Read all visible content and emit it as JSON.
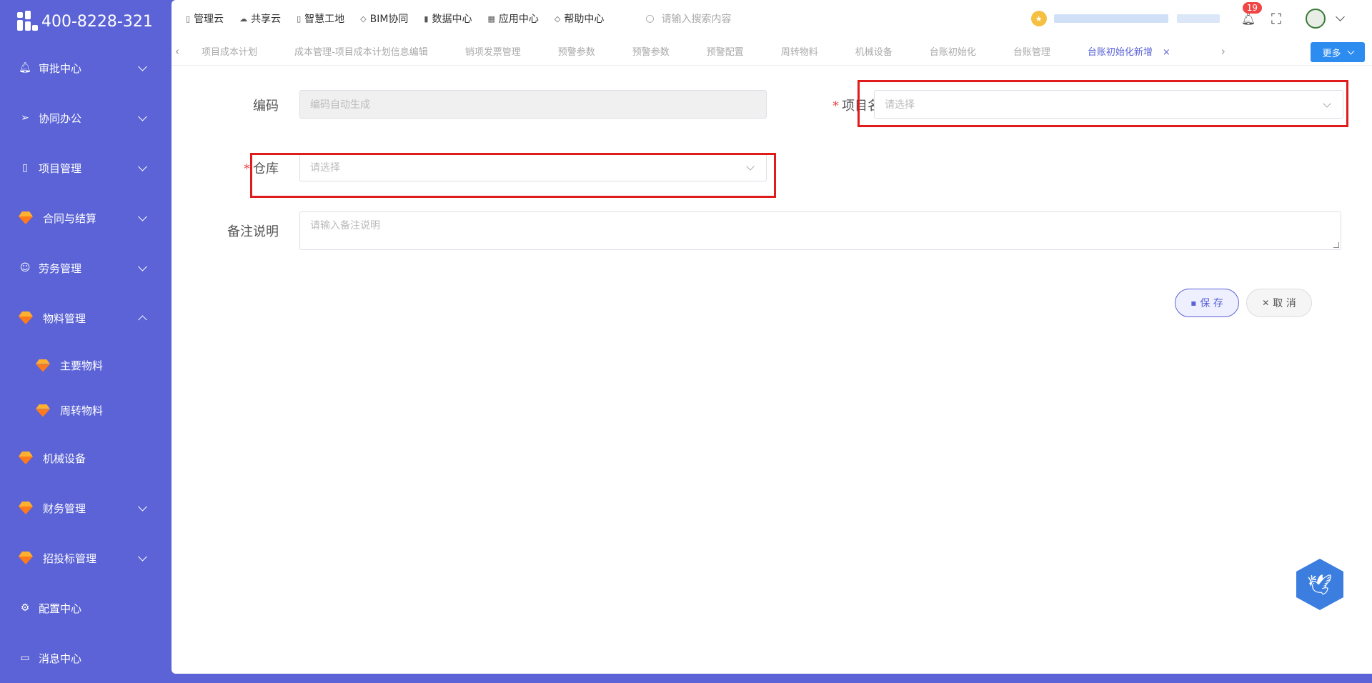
{
  "brand": {
    "phone": "400-8228-321"
  },
  "sidebar": {
    "items": [
      {
        "label": "审批中心",
        "icon": "bell-icon"
      },
      {
        "label": "协同办公",
        "icon": "send-icon"
      },
      {
        "label": "项目管理",
        "icon": "book-icon"
      },
      {
        "label": "合同与结算",
        "icon": "gem-icon"
      },
      {
        "label": "劳务管理",
        "icon": "user-icon"
      },
      {
        "label": "物料管理",
        "icon": "gem-icon"
      },
      {
        "label": "主要物料",
        "icon": "gem-icon"
      },
      {
        "label": "周转物料",
        "icon": "gem-icon"
      },
      {
        "label": "机械设备",
        "icon": "gem-icon"
      },
      {
        "label": "财务管理",
        "icon": "gem-icon"
      },
      {
        "label": "招投标管理",
        "icon": "gem-icon"
      },
      {
        "label": "配置中心",
        "icon": "gear-icon"
      },
      {
        "label": "消息中心",
        "icon": "message-icon"
      }
    ]
  },
  "topbar": {
    "menu": [
      "管理云",
      "共享云",
      "智慧工地",
      "BIM协同",
      "数据中心",
      "应用中心",
      "帮助中心"
    ],
    "search_placeholder": "请输入搜索内容",
    "notification_count": "19"
  },
  "tabs": {
    "items": [
      "项目成本计划",
      "成本管理-项目成本计划信息编辑",
      "销项发票管理",
      "预警参数",
      "预警参数",
      "预警配置",
      "周转物料",
      "机械设备",
      "台账初始化",
      "台账管理"
    ],
    "active": "台账初始化新增",
    "more_label": "更多"
  },
  "form": {
    "code_label": "编码",
    "code_placeholder": "编码自动生成",
    "project_label": "项目名称",
    "project_placeholder": "请选择",
    "warehouse_label": "仓库",
    "warehouse_placeholder": "请选择",
    "remark_label": "备注说明",
    "remark_placeholder": "请输入备注说明",
    "required_mark": "*",
    "save_label": "保 存",
    "cancel_label": "取 消"
  },
  "colors": {
    "sidebar_bg": "#5b63d6",
    "highlight": "#e01b1b",
    "primary": "#2d8cf0"
  }
}
